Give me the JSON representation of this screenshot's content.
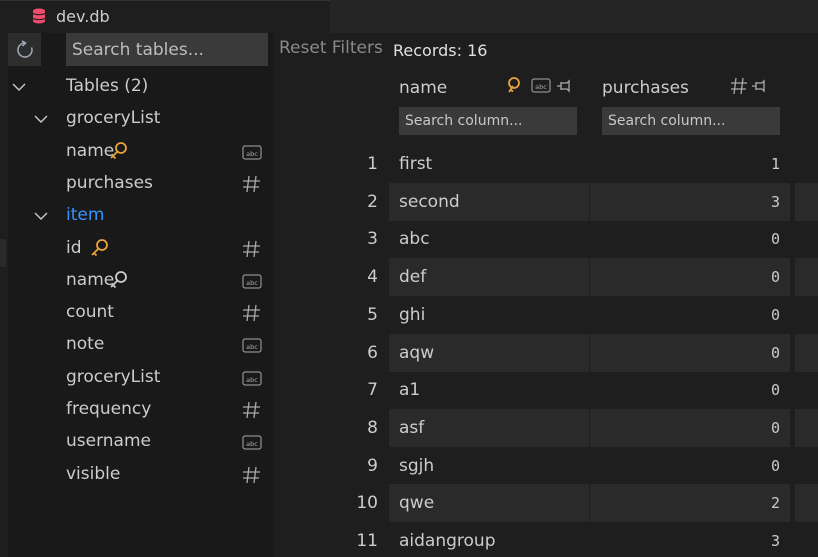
{
  "tab": {
    "title": "dev.db",
    "icon": "database-icon"
  },
  "sidebar": {
    "search_placeholder": "Search tables...",
    "tables_label": "Tables (2)",
    "tables": [
      {
        "name": "groceryList",
        "columns": [
          {
            "name": "name",
            "key": "primary",
            "type": "text"
          },
          {
            "name": "purchases",
            "key": "",
            "type": "number"
          }
        ]
      },
      {
        "name": "item",
        "columns": [
          {
            "name": "id",
            "key": "primary",
            "type": "number"
          },
          {
            "name": "name",
            "key": "foreign",
            "type": "text"
          },
          {
            "name": "count",
            "key": "",
            "type": "number"
          },
          {
            "name": "note",
            "key": "",
            "type": "text"
          },
          {
            "name": "groceryList",
            "key": "",
            "type": "text"
          },
          {
            "name": "frequency",
            "key": "",
            "type": "number"
          },
          {
            "name": "username",
            "key": "",
            "type": "text"
          },
          {
            "name": "visible",
            "key": "",
            "type": "number"
          }
        ]
      }
    ]
  },
  "toolbar": {
    "reset_filters": "Reset Filters",
    "records": "Records: 16"
  },
  "grid": {
    "columns": [
      {
        "name": "name",
        "search_placeholder": "Search column..."
      },
      {
        "name": "purchases",
        "search_placeholder": "Search column..."
      }
    ],
    "rows": [
      {
        "n": "1",
        "name": "first",
        "purchases": "1"
      },
      {
        "n": "2",
        "name": "second",
        "purchases": "3"
      },
      {
        "n": "3",
        "name": "abc",
        "purchases": "0"
      },
      {
        "n": "4",
        "name": "def",
        "purchases": "0"
      },
      {
        "n": "5",
        "name": "ghi",
        "purchases": "0"
      },
      {
        "n": "6",
        "name": "aqw",
        "purchases": "0"
      },
      {
        "n": "7",
        "name": "a1",
        "purchases": "0"
      },
      {
        "n": "8",
        "name": "asf",
        "purchases": "0"
      },
      {
        "n": "9",
        "name": "sgjh",
        "purchases": "0"
      },
      {
        "n": "10",
        "name": "qwe",
        "purchases": "2"
      },
      {
        "n": "11",
        "name": "aidangroup",
        "purchases": "3"
      }
    ]
  },
  "colors": {
    "key_primary": "#e8a43a",
    "key_foreign": "#cccccc",
    "selected_table": "#3794ff",
    "db_icon": "#f14c6c"
  }
}
